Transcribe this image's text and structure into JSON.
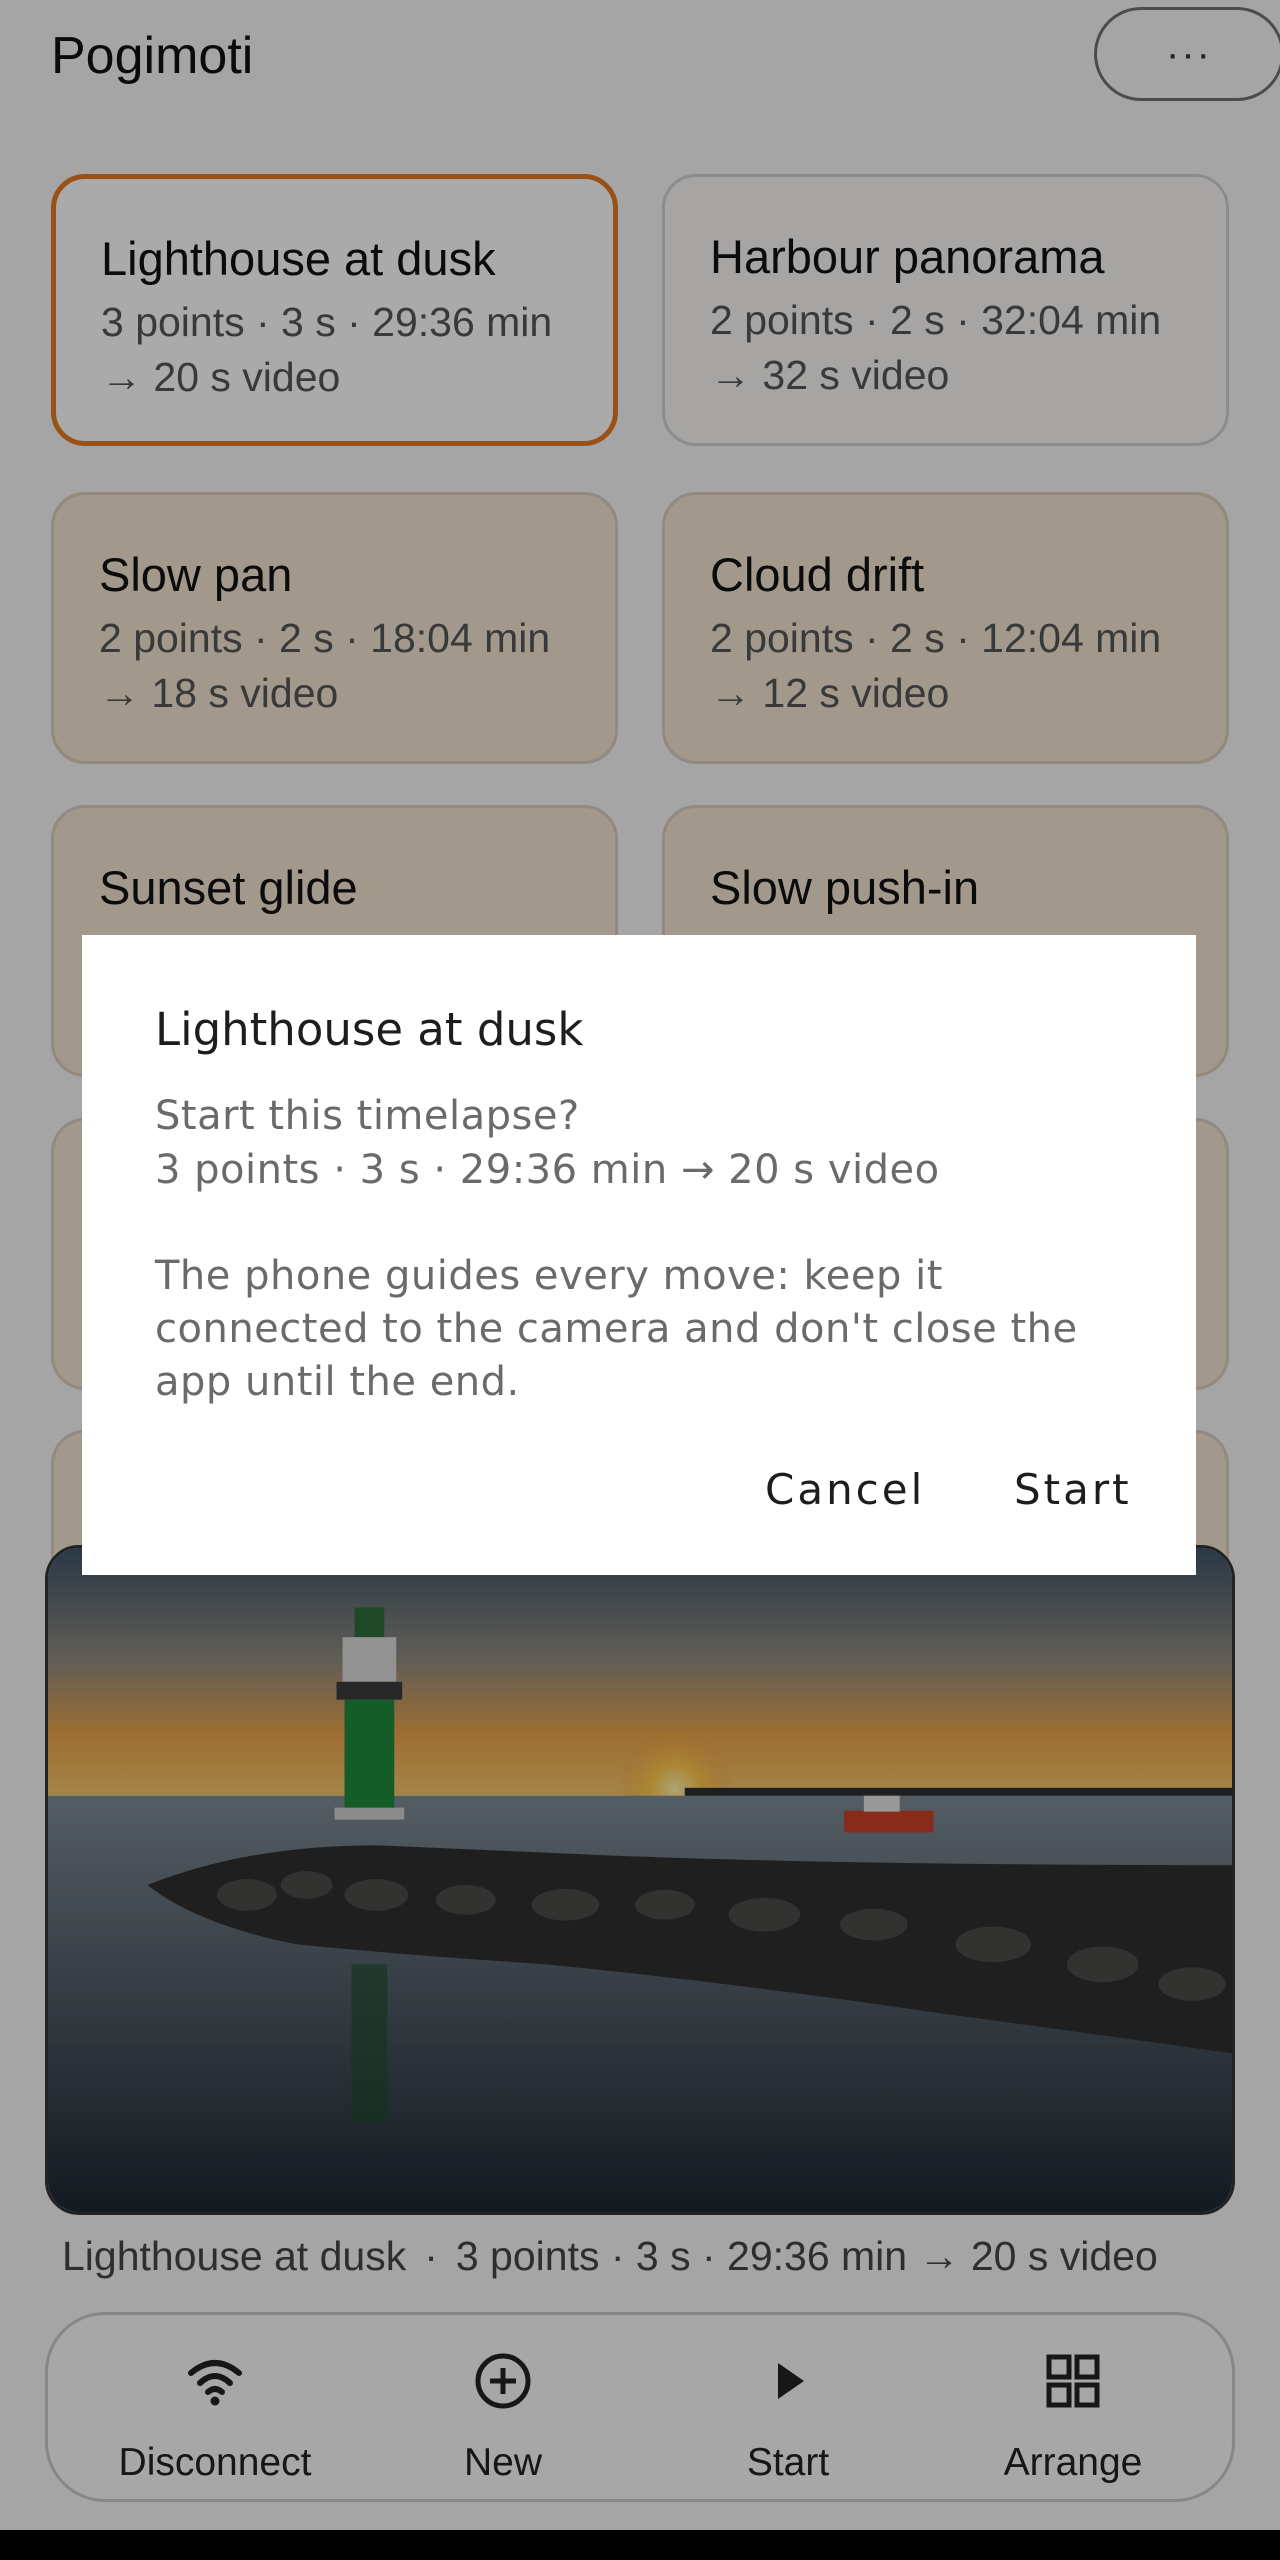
{
  "app": {
    "title": "Pogimoti",
    "more_label": "···"
  },
  "cards": [
    {
      "name": "Lighthouse at dusk",
      "meta": "3 points · 3 s · 29:36 min",
      "video": "→ 20 s video",
      "selected": true
    },
    {
      "name": "Harbour panorama",
      "meta": "2 points · 2 s · 32:04 min",
      "video": "→ 32 s video"
    },
    {
      "name": "Slow pan",
      "meta": "2 points · 2 s · 18:04 min",
      "video": "→ 18 s video"
    },
    {
      "name": "Cloud drift",
      "meta": "2 points · 2 s · 12:04 min",
      "video": "→ 12 s video"
    },
    {
      "name": "Sunset glide"
    },
    {
      "name": "Slow push-in"
    }
  ],
  "preview": {
    "caption_name": "Lighthouse at dusk",
    "caption_sep": "·",
    "caption_meta": "3 points · 3 s · 29:36 min → 20 s video"
  },
  "bottom_nav": [
    {
      "label": "Disconnect",
      "icon": "wifi-icon"
    },
    {
      "label": "New",
      "icon": "add-circle-icon"
    },
    {
      "label": "Start",
      "icon": "play-icon"
    },
    {
      "label": "Arrange",
      "icon": "grid-icon"
    }
  ],
  "dialog": {
    "title": "Lighthouse at dusk",
    "question": "Start this timelapse?",
    "summary": "3 points · 3 s · 29:36 min → 20 s video",
    "note_line1": "The phone guides every move: keep it",
    "note_line2": "connected to the camera and don't close the",
    "note_line3": "app until the end.",
    "cancel_label": "Cancel",
    "start_label": "Start"
  },
  "colors": {
    "accent": "#e07a22",
    "card_tan": "#efe0cf",
    "scrim": "rgba(0,0,0,0.32)"
  }
}
